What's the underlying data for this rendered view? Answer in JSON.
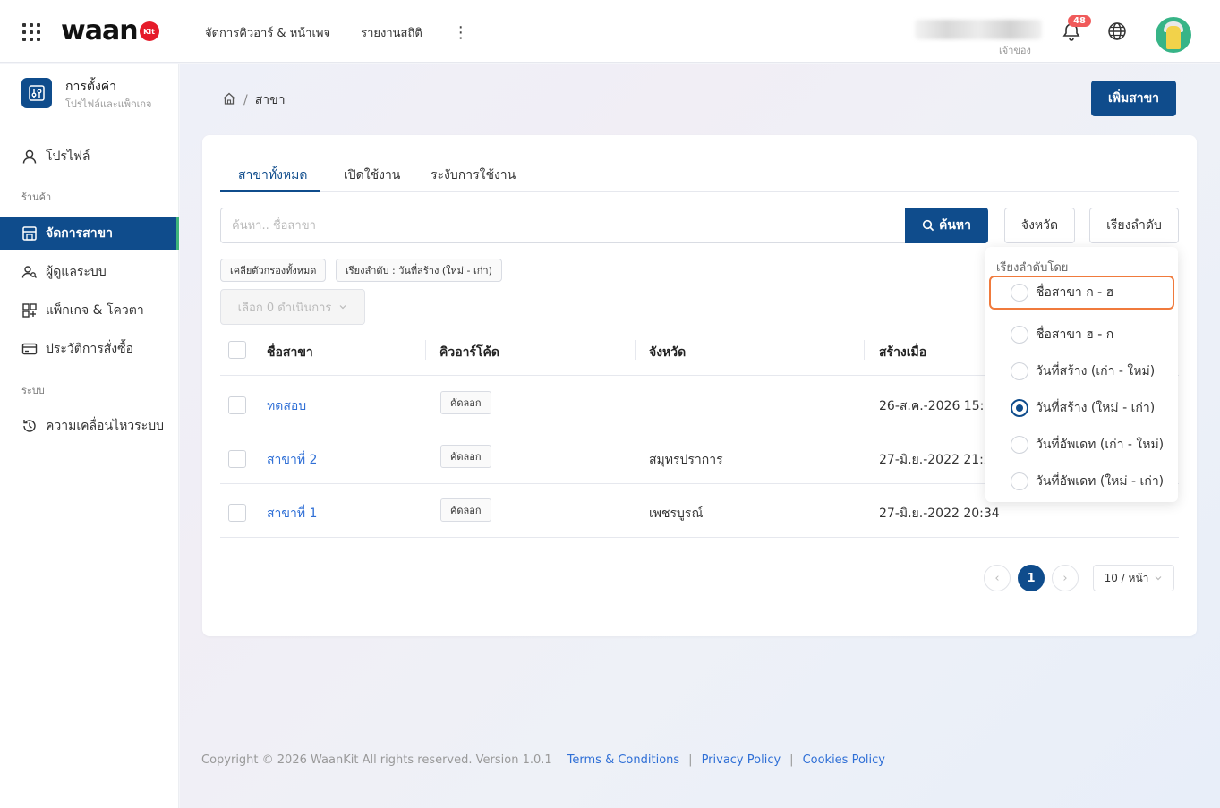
{
  "header": {
    "logo_text": "waan",
    "logo_badge": "Kit",
    "nav": [
      "จัดการคิวอาร์ & หน้าเพจ",
      "รายงานสถิติ"
    ],
    "more_icon": "kebab-icon",
    "user_role": "เจ้าของ",
    "notification_count": "48",
    "brand_color": "#0f4c8c",
    "badge_color": "#f05a5a"
  },
  "sidebar": {
    "title": "การตั้งค่า",
    "subtitle": "โปรไฟล์และแพ็กเกจ",
    "profile": "โปรไฟล์",
    "section_store": "ร้านค้า",
    "items": [
      {
        "label": "จัดการสาขา",
        "icon": "store-icon",
        "active": true
      },
      {
        "label": "ผู้ดูแลระบบ",
        "icon": "users-icon"
      },
      {
        "label": "แพ็กเกจ & โควตา",
        "icon": "package-icon"
      },
      {
        "label": "ประวัติการสั่งซื้อ",
        "icon": "credit-card-icon"
      }
    ],
    "section_system": "ระบบ",
    "system_items": [
      {
        "label": "ความเคลื่อนไหวระบบ",
        "icon": "history-icon"
      }
    ]
  },
  "breadcrumb": {
    "current": "สาขา"
  },
  "add_branch_label": "เพิ่มสาขา",
  "tabs": [
    "สาขาทั้งหมด",
    "เปิดใช้งาน",
    "ระงับการใช้งาน"
  ],
  "search": {
    "placeholder": "ค้นหา.. ชื่อสาขา",
    "button": "ค้นหา"
  },
  "filters": {
    "province": "จังหวัด",
    "sort": "เรียงลำดับ"
  },
  "chips": {
    "clear": "เคลียตัวกรองทั้งหมด",
    "sort": "เรียงลำดับ : วันที่สร้าง (ใหม่ - เก่า)"
  },
  "bulk_action": "เลือก 0 ดำเนินการ",
  "table": {
    "columns": [
      "ชื่อสาขา",
      "คิวอาร์โค้ด",
      "จังหวัด",
      "สร้างเมื่อ"
    ],
    "copy_label": "คัดลอก",
    "rows": [
      {
        "name": "ทดสอบ",
        "province": "",
        "created": "26-ส.ค.-2026 15:14"
      },
      {
        "name": "สาขาที่ 2",
        "province": "สมุทรปราการ",
        "created": "27-มิ.ย.-2022 21:24"
      },
      {
        "name": "สาขาที่ 1",
        "province": "เพชรบูรณ์",
        "created": "27-มิ.ย.-2022 20:34"
      }
    ]
  },
  "pagination": {
    "current": "1",
    "page_size": "10 / หน้า",
    "prev": "‹",
    "next": "›"
  },
  "sort_dropdown": {
    "title": "เรียงลำดับโดย",
    "options": [
      {
        "label": "ชื่อสาขา ก - ฮ",
        "checked": false
      },
      {
        "label": "ชื่อสาขา ฮ - ก",
        "checked": false
      },
      {
        "label": "วันที่สร้าง (เก่า - ใหม่)",
        "checked": false
      },
      {
        "label": "วันที่สร้าง (ใหม่ - เก่า)",
        "checked": true
      },
      {
        "label": "วันที่อัพเดท (เก่า - ใหม่)",
        "checked": false
      },
      {
        "label": "วันที่อัพเดท (ใหม่ - เก่า)",
        "checked": false
      }
    ]
  },
  "footer": {
    "copyright": "Copyright © 2026 WaanKit All rights reserved. Version 1.0.1",
    "links": [
      "Terms & Conditions",
      "Privacy Policy",
      "Cookies Policy"
    ]
  }
}
